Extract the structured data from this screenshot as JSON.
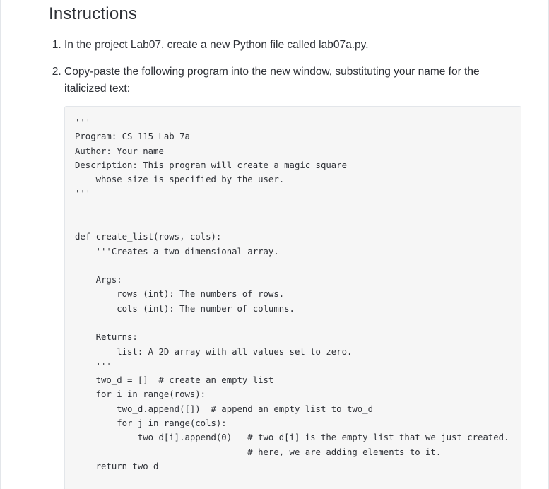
{
  "heading": "Instructions",
  "steps": {
    "one": "In the project Lab07, create a new Python file called lab07a.py.",
    "two": "Copy-paste the following program into the new window, substituting your name for the italicized text:"
  },
  "code": "'''\nProgram: CS 115 Lab 7a\nAuthor: Your name\nDescription: This program will create a magic square\n    whose size is specified by the user.\n'''\n\n\ndef create_list(rows, cols):\n    '''Creates a two-dimensional array.\n\n    Args:\n        rows (int): The numbers of rows.\n        cols (int): The number of columns.\n\n    Returns:\n        list: A 2D array with all values set to zero.\n    '''\n    two_d = []  # create an empty list\n    for i in range(rows):\n        two_d.append([])  # append an empty list to two_d\n        for j in range(cols):\n            two_d[i].append(0)   # two_d[i] is the empty list that we just created.\n                                 # here, we are adding elements to it.\n    return two_d\n\n\ndef rjust_by_n(number, n):\n    '''Formats a string containing 'number', right-justified.\n\n    Args:"
}
